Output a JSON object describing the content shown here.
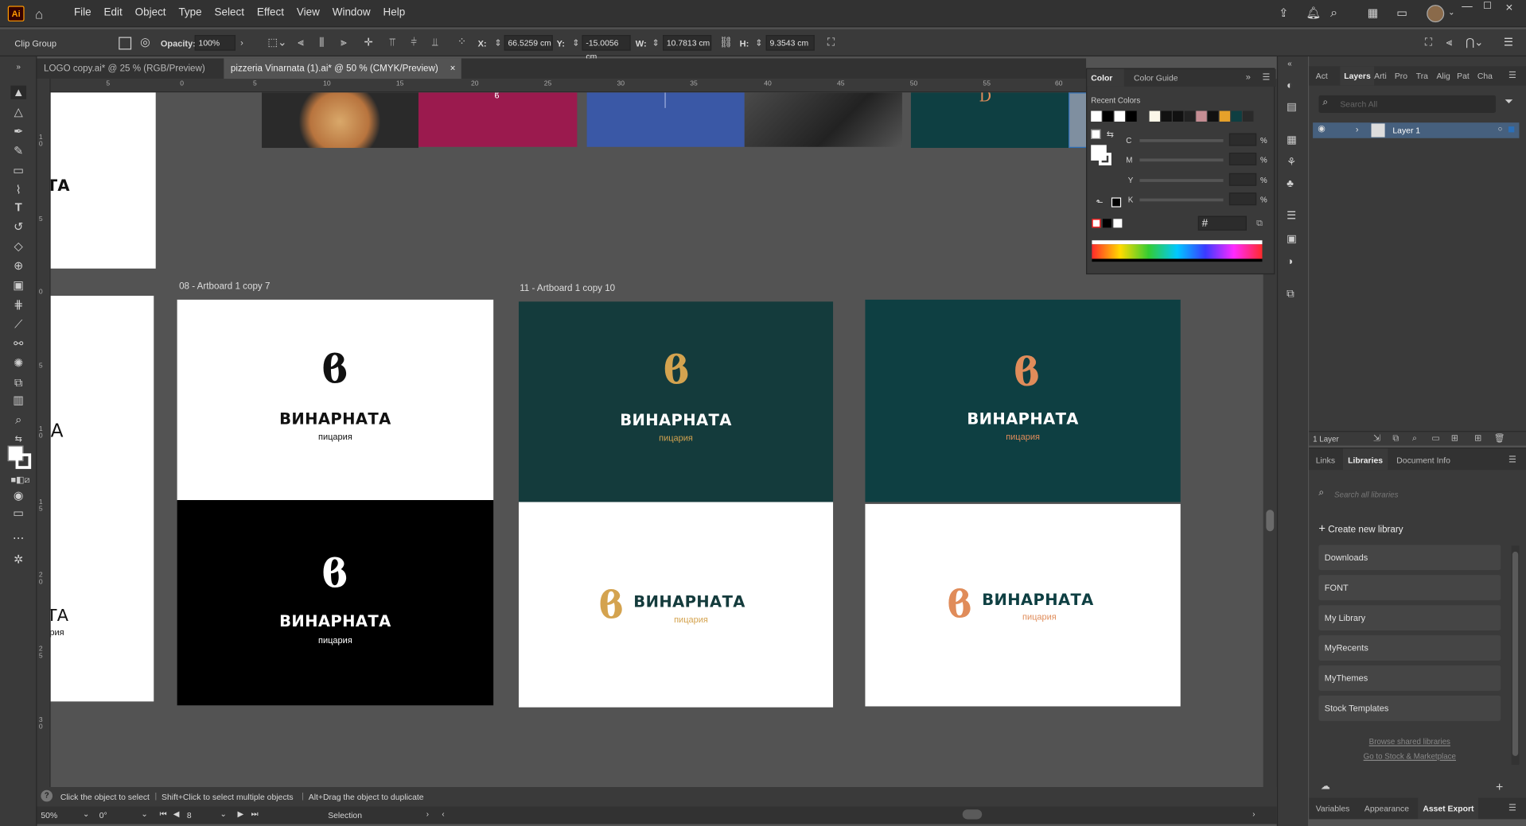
{
  "app": {
    "logo": "Ai",
    "menus": [
      "File",
      "Edit",
      "Object",
      "Type",
      "Select",
      "Effect",
      "View",
      "Window",
      "Help"
    ]
  },
  "control": {
    "selection_type": "Clip Group",
    "opacity_label": "Opacity:",
    "opacity_value": "100%",
    "x_label": "X:",
    "x_value": "66.5259 cm",
    "y_label": "Y:",
    "y_value": "-15.0056 cm",
    "w_label": "W:",
    "w_value": "10.7813 cm",
    "h_label": "H:",
    "h_value": "9.3543 cm"
  },
  "tabs": [
    {
      "label": "LOGO copy.ai* @ 25 % (RGB/Preview)",
      "close": "×"
    },
    {
      "label": "pizzeria Vinarnata (1).ai* @ 50 % (CMYK/Preview)",
      "close": "×"
    }
  ],
  "ruler": {
    "h": [
      "5",
      "0",
      "5",
      "10",
      "15",
      "20",
      "25",
      "30",
      "35",
      "40",
      "45",
      "50",
      "55",
      "60"
    ],
    "v": [
      "1 0",
      "5",
      "0",
      "5",
      "1 0",
      "1 5",
      "2 0",
      "2 5",
      "3 0"
    ]
  },
  "canvas": {
    "artboard_label_1": "08 - Artboard 1 copy 7",
    "artboard_label_2": "11 - Artboard 1 copy 10",
    "monogram": "ϐ",
    "brand": "ВИНАРНАТА",
    "sub": "пицария",
    "left_partial_1": "ТА",
    "left_partial_2": "А",
    "left_partial_3": "ТА",
    "left_partial_4": "ария",
    "top_letter": "D"
  },
  "colors": {
    "teal": "#143b3c",
    "teal2": "#0e3f42",
    "gold": "#d4a34f",
    "orange": "#e08c5a",
    "crimson": "#9b1a4e",
    "blue": "#3a58a6",
    "black": "#000000",
    "white": "#ffffff",
    "accent_blue": "#2b6fb8"
  },
  "color_panel": {
    "tab_color": "Color",
    "tab_guide": "Color Guide",
    "recent": "Recent Colors",
    "c": "C",
    "m": "M",
    "y": "Y",
    "k": "K",
    "pct": "%",
    "hex": "#"
  },
  "layers": {
    "tabs": [
      "Act",
      "Layers",
      "Arti",
      "Pro",
      "Tra",
      "Alig",
      "Pat",
      "Cha"
    ],
    "search_placeholder": "Search All",
    "layer_name": "Layer 1",
    "count": "1 Layer"
  },
  "libraries": {
    "tabs": [
      "Links",
      "Libraries",
      "Document Info"
    ],
    "search_placeholder": "Search all libraries",
    "create": "Create new library",
    "items": [
      "Downloads",
      "FONT",
      "My Library",
      "MyRecents",
      "MyThemes",
      "Stock Templates"
    ],
    "browse": "Browse shared libraries",
    "stock": "Go to Stock & Marketplace"
  },
  "bottom_tabs": [
    "Variables",
    "Appearance",
    "Asset Export"
  ],
  "status": {
    "hint1": "Click the object to select",
    "hint2": "Shift+Click to select multiple objects",
    "hint3": "Alt+Drag the object to duplicate",
    "zoom": "50%",
    "rotation": "0°",
    "page": "8",
    "mode": "Selection"
  }
}
